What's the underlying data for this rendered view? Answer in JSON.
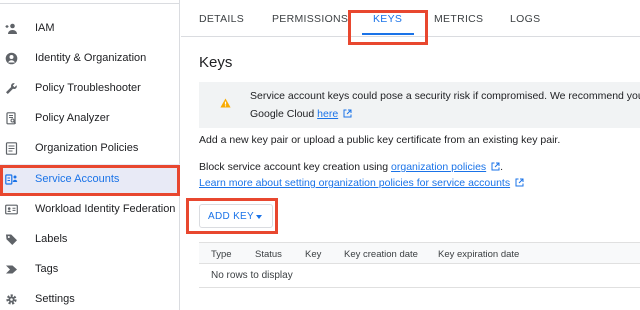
{
  "sidebar": {
    "items": [
      {
        "label": "IAM",
        "icon": "person-add-icon"
      },
      {
        "label": "Identity & Organization",
        "icon": "account-circle-icon"
      },
      {
        "label": "Policy Troubleshooter",
        "icon": "wrench-icon"
      },
      {
        "label": "Policy Analyzer",
        "icon": "document-search-icon"
      },
      {
        "label": "Organization Policies",
        "icon": "list-document-icon"
      },
      {
        "label": "Service Accounts",
        "icon": "service-account-icon",
        "active": true
      },
      {
        "label": "Workload Identity Federation",
        "icon": "id-card-icon"
      },
      {
        "label": "Labels",
        "icon": "label-icon"
      },
      {
        "label": "Tags",
        "icon": "tag-chevron-icon"
      },
      {
        "label": "Settings",
        "icon": "gear-icon"
      }
    ]
  },
  "tabs": [
    {
      "label": "DETAILS"
    },
    {
      "label": "PERMISSIONS"
    },
    {
      "label": "KEYS",
      "active": true
    },
    {
      "label": "METRICS"
    },
    {
      "label": "LOGS"
    }
  ],
  "main": {
    "title": "Keys",
    "warning": {
      "line1": "Service account keys could pose a security risk if compromised. We recommend you avoi",
      "line2_prefix": "Google Cloud ",
      "line2_link": "here"
    },
    "add_text": "Add a new key pair or upload a public key certificate from an existing key pair.",
    "block_prefix": "Block service account key creation using ",
    "block_link": "organization policies",
    "block_suffix": ".",
    "learn_link": "Learn more about setting organization policies for service accounts",
    "add_key_label": "ADD KEY",
    "table": {
      "headers": [
        "Type",
        "Status",
        "Key",
        "Key creation date",
        "Key expiration date"
      ],
      "empty": "No rows to display"
    }
  },
  "colors": {
    "accent": "#1a73e8",
    "highlight": "#e8472f",
    "warning": "#f9ab00"
  }
}
